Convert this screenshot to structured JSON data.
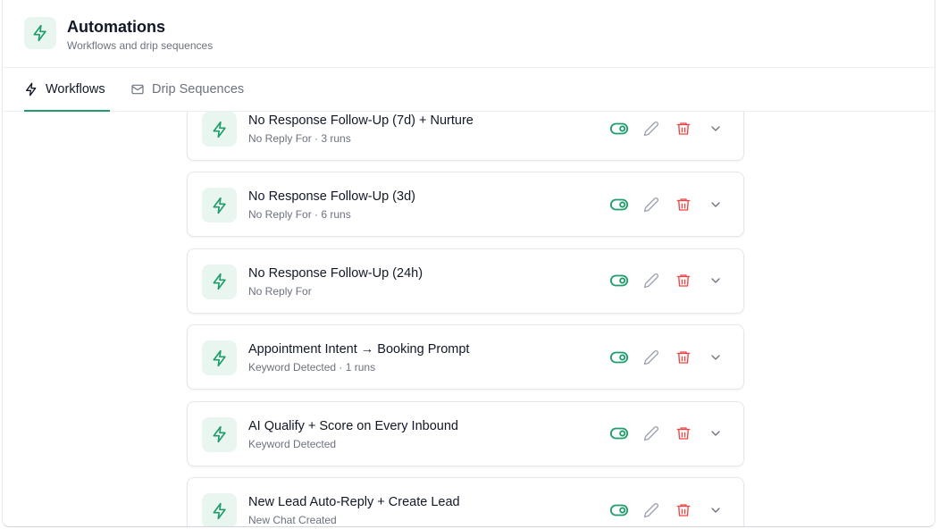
{
  "header": {
    "title": "Automations",
    "subtitle": "Workflows and drip sequences",
    "icon": "lightning-icon"
  },
  "tabs": [
    {
      "label": "Workflows",
      "icon": "lightning-icon",
      "active": true
    },
    {
      "label": "Drip Sequences",
      "icon": "mail-icon",
      "active": false
    }
  ],
  "colors": {
    "accent": "#1f9d6b",
    "accent_bg": "#e9f6ef",
    "delete": "#ef4444",
    "muted": "#6b7280"
  },
  "workflows": [
    {
      "title": "No Response Follow-Up (7d) + Nurture",
      "subtitle": "No Reply For · 3 runs"
    },
    {
      "title": "No Response Follow-Up (3d)",
      "subtitle": "No Reply For · 6 runs"
    },
    {
      "title": "No Response Follow-Up (24h)",
      "subtitle": "No Reply For"
    },
    {
      "title": "Appointment Intent → Booking Prompt",
      "subtitle": "Keyword Detected · 1 runs"
    },
    {
      "title": "AI Qualify + Score on Every Inbound",
      "subtitle": "Keyword Detected"
    },
    {
      "title": "New Lead Auto-Reply + Create Lead",
      "subtitle": "New Chat Created"
    }
  ]
}
